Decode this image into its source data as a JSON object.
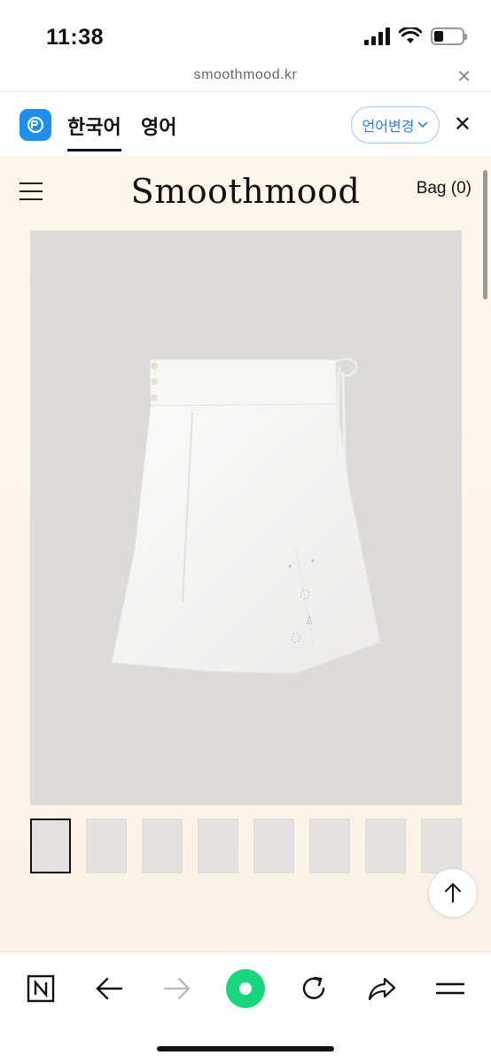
{
  "status_bar": {
    "time": "11:38"
  },
  "browser": {
    "url": "smoothmood.kr"
  },
  "translate_bar": {
    "tabs": [
      "한국어",
      "영어"
    ],
    "change_label": "언어변경",
    "accent_color": "#1d8ff0"
  },
  "site": {
    "logo": "Smoothmood",
    "bag_label": "Bag (0)",
    "background": "#fcf5e9",
    "product_image": "white-midi-skirt-photo",
    "thumbnail_count": 8,
    "selected_thumbnail": 1
  },
  "toolbar": {
    "items": [
      "naver-icon",
      "back-icon",
      "forward-icon",
      "green-dot-button",
      "refresh-icon",
      "share-icon",
      "menu-icon"
    ]
  }
}
